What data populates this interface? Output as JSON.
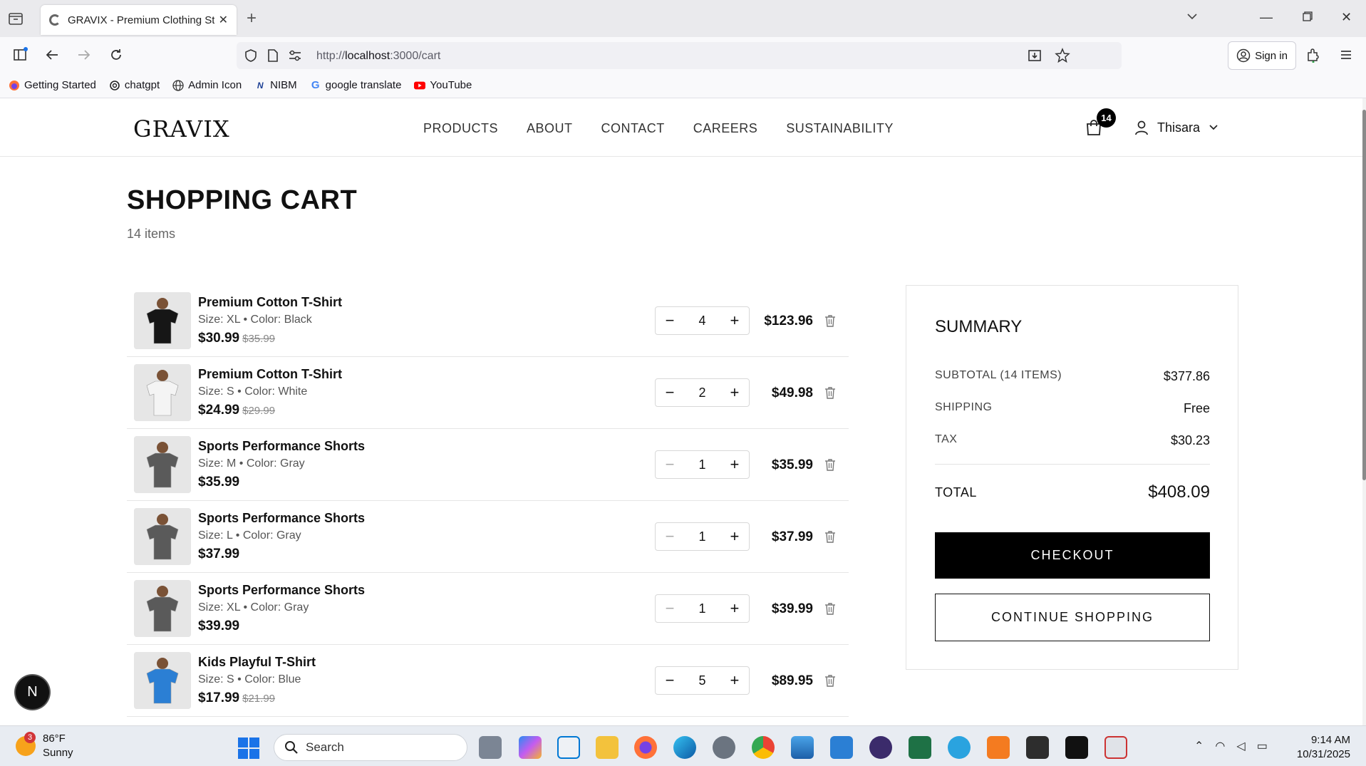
{
  "browser": {
    "tab_title": "GRAVIX - Premium Clothing Sto",
    "url_prefix": "http://",
    "url_host": "localhost",
    "url_rest": ":3000/cart",
    "sign_in_label": "Sign in",
    "bookmarks": [
      {
        "label": "Getting Started",
        "icon": "firefox-icon"
      },
      {
        "label": "chatgpt",
        "icon": "chatgpt-icon"
      },
      {
        "label": "Admin Icon",
        "icon": "globe-icon"
      },
      {
        "label": "NIBM",
        "icon": "nibm-icon"
      },
      {
        "label": "google translate",
        "icon": "google-icon"
      },
      {
        "label": "YouTube",
        "icon": "youtube-icon"
      }
    ]
  },
  "site": {
    "logo": "GRAVIX",
    "nav": [
      "PRODUCTS",
      "ABOUT",
      "CONTACT",
      "CAREERS",
      "SUSTAINABILITY"
    ],
    "cart_count": "14",
    "user_name": "Thisara"
  },
  "cart": {
    "title": "SHOPPING CART",
    "count_label": "14 items",
    "items": [
      {
        "name": "Premium Cotton T-Shirt",
        "size_label": "Size:",
        "size": "XL",
        "color_label": "Color:",
        "color": "Black",
        "price": "$30.99",
        "original_price": "$35.99",
        "qty": "4",
        "line_total": "$123.96",
        "minus_enabled": true,
        "swatch": "#161616"
      },
      {
        "name": "Premium Cotton T-Shirt",
        "size_label": "Size:",
        "size": "S",
        "color_label": "Color:",
        "color": "White",
        "price": "$24.99",
        "original_price": "$29.99",
        "qty": "2",
        "line_total": "$49.98",
        "minus_enabled": true,
        "swatch": "#f4f4f4"
      },
      {
        "name": "Sports Performance Shorts",
        "size_label": "Size:",
        "size": "M",
        "color_label": "Color:",
        "color": "Gray",
        "price": "$35.99",
        "original_price": "",
        "qty": "1",
        "line_total": "$35.99",
        "minus_enabled": false,
        "swatch": "#5a5a5a"
      },
      {
        "name": "Sports Performance Shorts",
        "size_label": "Size:",
        "size": "L",
        "color_label": "Color:",
        "color": "Gray",
        "price": "$37.99",
        "original_price": "",
        "qty": "1",
        "line_total": "$37.99",
        "minus_enabled": false,
        "swatch": "#5a5a5a"
      },
      {
        "name": "Sports Performance Shorts",
        "size_label": "Size:",
        "size": "XL",
        "color_label": "Color:",
        "color": "Gray",
        "price": "$39.99",
        "original_price": "",
        "qty": "1",
        "line_total": "$39.99",
        "minus_enabled": false,
        "swatch": "#5a5a5a"
      },
      {
        "name": "Kids Playful T-Shirt",
        "size_label": "Size:",
        "size": "S",
        "color_label": "Color:",
        "color": "Blue",
        "price": "$17.99",
        "original_price": "$21.99",
        "qty": "5",
        "line_total": "$89.95",
        "minus_enabled": true,
        "swatch": "#2b7fd4"
      }
    ]
  },
  "summary": {
    "title": "SUMMARY",
    "subtotal_label": "SUBTOTAL (14 ITEMS)",
    "subtotal": "$377.86",
    "shipping_label": "SHIPPING",
    "shipping": "Free",
    "tax_label": "TAX",
    "tax": "$30.23",
    "total_label": "TOTAL",
    "total": "$408.09",
    "checkout_label": "CHECKOUT",
    "continue_label": "CONTINUE SHOPPING"
  },
  "dev_badge": "N",
  "taskbar": {
    "temp": "86°F",
    "condition": "Sunny",
    "weather_badge": "3",
    "search_placeholder": "Search",
    "time": "9:14 AM",
    "date": "10/31/2025"
  },
  "colors": {
    "accent": "#000000",
    "youtube": "#ff0000",
    "windows_blue": "#1a73e8"
  }
}
